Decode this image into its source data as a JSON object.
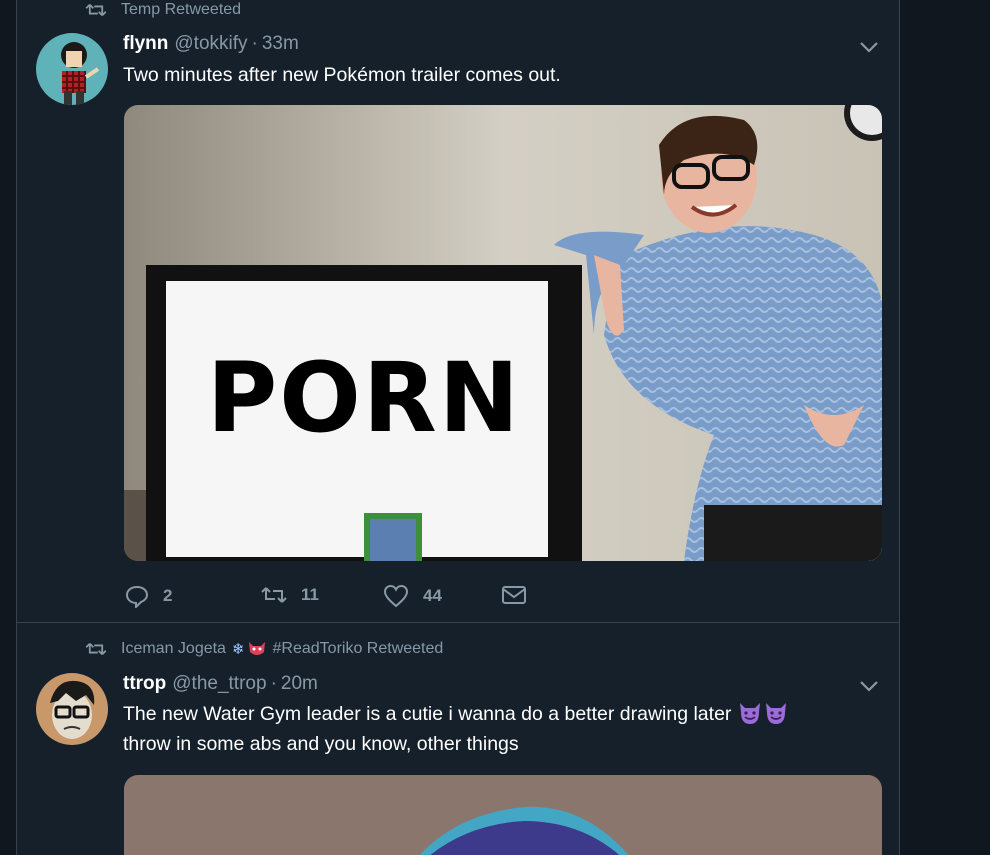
{
  "tweets": [
    {
      "retweeted_by": "Temp Retweeted",
      "name": "flynn",
      "handle": "@tokkify",
      "time": "33m",
      "text": "Two minutes after new Pokémon trailer comes out.",
      "media_text": "PORN",
      "actions": {
        "replies": "2",
        "retweets": "11",
        "likes": "44"
      }
    },
    {
      "retweeted_by_name": "Iceman Jogeta",
      "retweeted_by_suffix": "#ReadToriko Retweeted",
      "name": "ttrop",
      "handle": "@the_ttrop",
      "time": "20m",
      "text_line1": "The new Water Gym leader is a cutie i wanna do a better drawing later",
      "text_line2": "throw in some abs and you know, other things"
    }
  ],
  "icons": {
    "retweet": "retweet-icon",
    "caret": "chevron-down-icon",
    "reply": "reply-icon",
    "like": "heart-icon",
    "dm": "envelope-icon",
    "snowflake": "snowflake-icon",
    "devil": "smiling-devil-icon"
  },
  "colors": {
    "background": "#15202b",
    "page": "#10171e",
    "muted": "#8899a6",
    "border": "#38444d"
  }
}
